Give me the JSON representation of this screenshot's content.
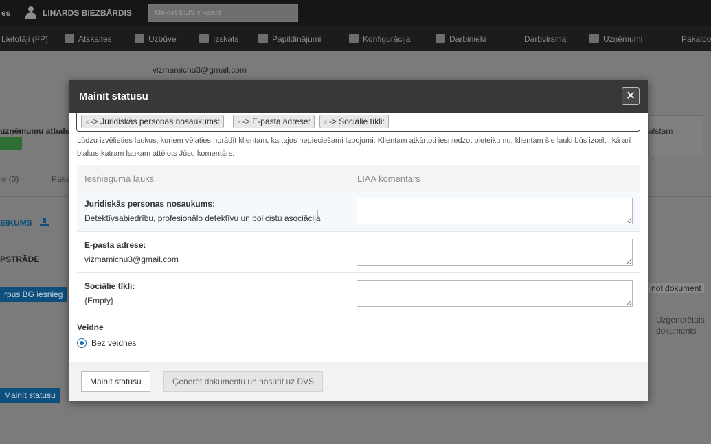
{
  "topbar": {
    "left_fragment": "es",
    "user_name": "LINARDS BIEZBĀRDIS",
    "search_placeholder": "Meklēt ELIS rīkjoslā"
  },
  "nav": {
    "items": [
      {
        "label": "Lietotāji (FP)",
        "icon": "users-icon"
      },
      {
        "label": "Atskaites",
        "icon": "chart-icon"
      },
      {
        "label": "Uzbūve",
        "icon": "structure-icon"
      },
      {
        "label": "Izskats",
        "icon": "brush-icon"
      },
      {
        "label": "Papildinājumi",
        "icon": "plugin-icon"
      },
      {
        "label": "Konfigurācija",
        "icon": "wrench-icon"
      },
      {
        "label": "Darbinieki",
        "icon": "staff-icon"
      },
      {
        "label": "Darbvirsma",
        "icon": ""
      },
      {
        "label": "Uzņēmumi",
        "icon": "company-icon"
      },
      {
        "label": "Pakalpo",
        "icon": ""
      }
    ]
  },
  "background": {
    "email": "vizmamichu3@gmail.com",
    "left_label_1": "uzņēmumu atbalst",
    "right_label_1": "alstam",
    "tab_1": "le (0)",
    "tab_2": "Paka",
    "section_1": "EIKUMS",
    "section_2": "PSTRĀDE",
    "blue_btn_1": "rpus BG iesnieg",
    "blue_btn_2": "Mainīt statusu",
    "right_btn": "not dokument",
    "right_text_1": "Uzģenerētais",
    "right_text_2": "dokuments"
  },
  "modal": {
    "title": "Mainīt statusu",
    "close_symbol": "✕",
    "tags": [
      "-> Juridiskās personas nosaukums:",
      "-> E-pasta adrese:",
      "-> Sociālie tīkli:"
    ],
    "tag_remove": "×",
    "hint": "Lūdzu izvēlieties laukus, kuriem vēlaties norādīt klientam, ka tajos nepieciešami labojumi. Klientam atkārtoti iesniedzot pieteikumu, klientam šie lauki būs izcelti, kā arī blakus katram laukam attēlots Jūsu komentārs.",
    "table": {
      "col_field": "Iesnieguma lauks",
      "col_comment": "LIAA komentārs",
      "rows": [
        {
          "label": "Juridiskās personas nosaukums:",
          "value": "Detektīvsabiedrību, profesionālo detektīvu un policistu asociācija"
        },
        {
          "label": "E-pasta adrese:",
          "value": "vizmamichu3@gmail.com"
        },
        {
          "label": "Sociālie tīkli:",
          "value": "{Empty}"
        }
      ]
    },
    "template_label": "Veidne",
    "template_option": "Bez veidnes",
    "buttons": {
      "change_status": "Mainīt statusu",
      "generate": "Ģenerēt dokumentu un nosūtīt uz DVS"
    }
  },
  "colors": {
    "header_bg": "#383838",
    "accent_blue": "#1a73b8",
    "overlay_bg": "#7b7b7b"
  }
}
